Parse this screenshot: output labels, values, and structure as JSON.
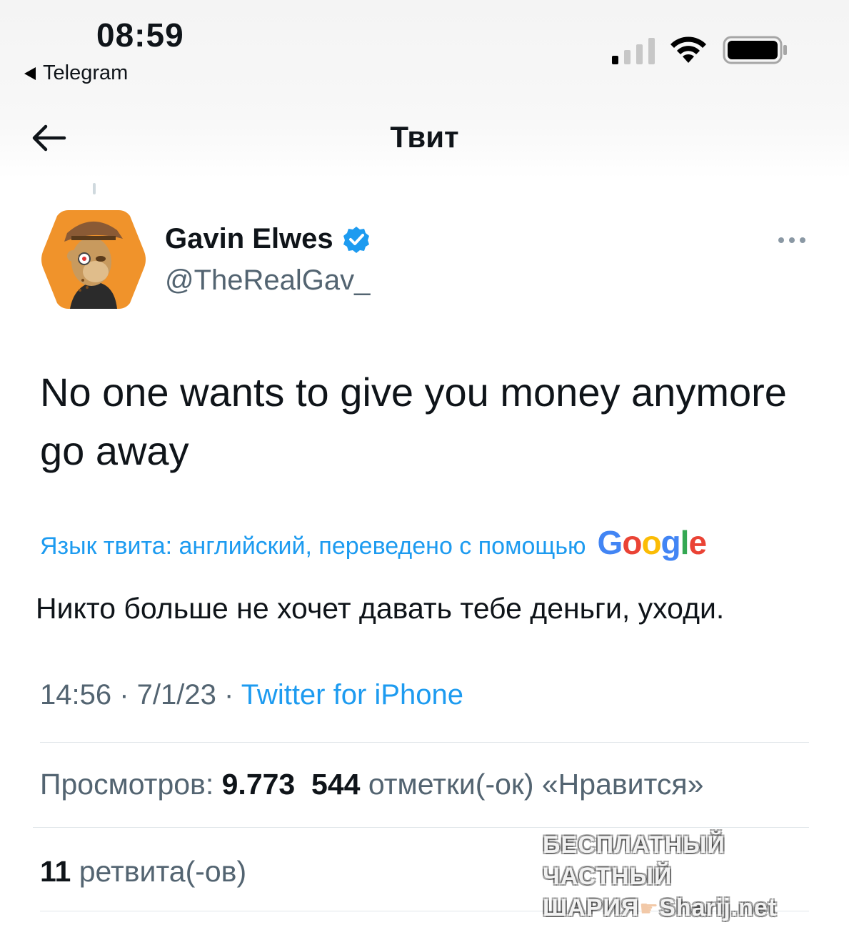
{
  "status_bar": {
    "time": "08:59",
    "back_app": "Telegram",
    "signal_icon": "cellular-signal-icon",
    "wifi_icon": "wifi-icon",
    "battery_icon": "battery-icon"
  },
  "nav": {
    "title": "Твит",
    "back_icon": "arrow-left-icon"
  },
  "tweet": {
    "author_name": "Gavin Elwes",
    "author_handle": "@TheRealGav_",
    "verified_icon": "verified-badge-icon",
    "more_icon": "more-dots-icon",
    "text": "No one wants to give you money anymore go away",
    "translation_label": "Язык твита: английский, переведено с помощью",
    "translation_provider": "Google",
    "translation_text": "Никто больше не хочет давать тебе деньги, уходи.",
    "time": "14:56",
    "date": "7/1/23",
    "source": "Twitter for iPhone",
    "meta_separator": " · "
  },
  "stats": {
    "views_label": "Просмотров:",
    "views_value": "9.773",
    "likes_value": "544",
    "likes_label": "отметки(-ок) «Нравится»",
    "retweets_value": "11",
    "retweets_label": "ретвита(-ов)"
  },
  "watermark": {
    "line1": "БЕСПЛАТНЫЙ ЧАСТНЫЙ",
    "line2_left": "ШАРИЯ",
    "line2_right": "Sharij.net"
  },
  "colors": {
    "accent_blue": "#1d9bf0",
    "secondary_text": "#536471",
    "primary_text": "#0f1419",
    "avatar_bg": "#f0932b"
  }
}
